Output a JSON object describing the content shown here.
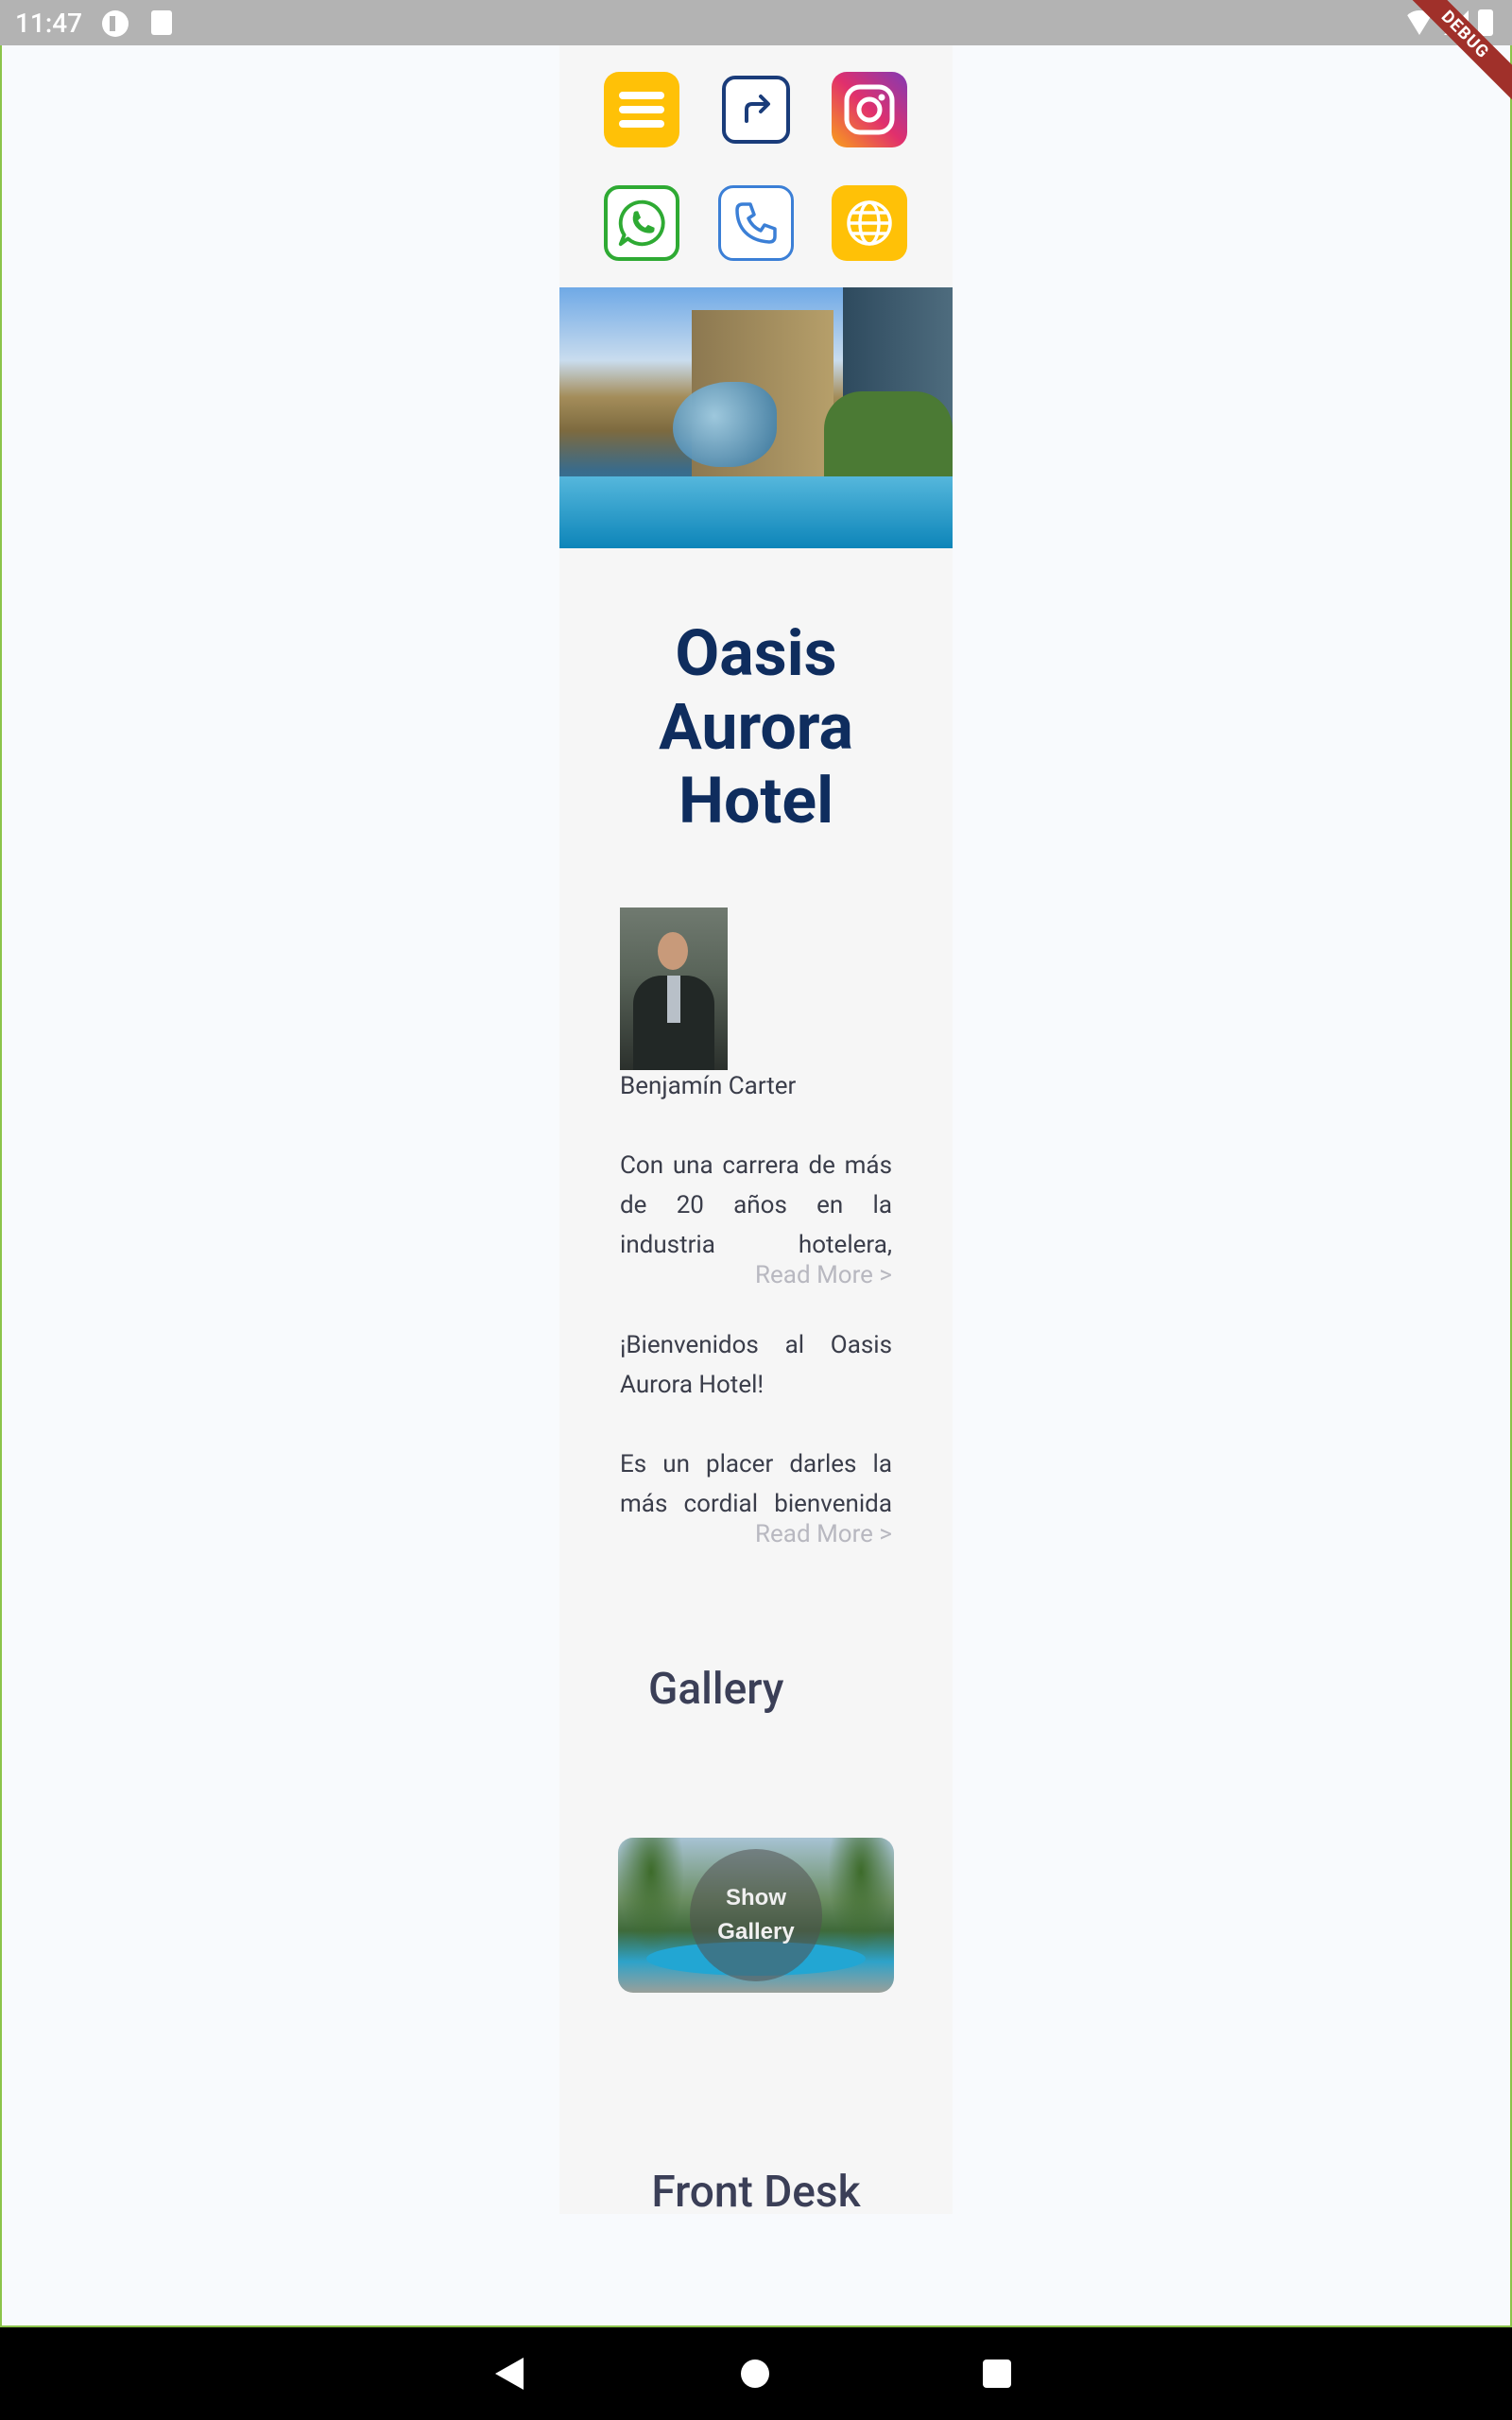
{
  "status_bar": {
    "time": "11:47",
    "debug_label": "DEBUG"
  },
  "icons": {
    "menu": "menu-icon",
    "share": "share-arrow-icon",
    "instagram": "instagram-icon",
    "whatsapp": "whatsapp-icon",
    "phone": "phone-icon",
    "website": "globe-icon"
  },
  "colors": {
    "accent_yellow": "#ffc107",
    "title_navy": "#0f2d5e",
    "whatsapp_green": "#2eaa33",
    "phone_blue": "#3b7fd6"
  },
  "hotel": {
    "title_lines": [
      "Oasis",
      "Aurora",
      "Hotel"
    ]
  },
  "manager": {
    "name": "Benjamín Carter",
    "bio_excerpt": "Con una carrera de más de 20 años en la industria hotelera,",
    "read_more": "Read More >"
  },
  "welcome": {
    "heading": "¡Bienvenidos al Oasis Aurora Hotel!",
    "excerpt": "Es un placer darles la más cordial bienvenida",
    "read_more": "Read More >"
  },
  "gallery": {
    "title": "Gallery",
    "button_label": "Show Gallery"
  },
  "front_desk": {
    "title": "Front Desk"
  }
}
